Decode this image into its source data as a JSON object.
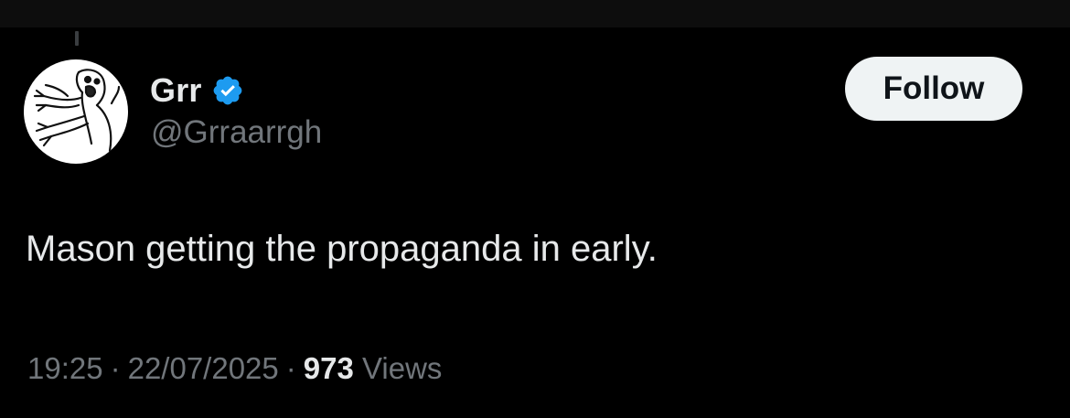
{
  "author": {
    "display_name": "Grr",
    "handle": "@Grraarrgh",
    "verified": true,
    "verified_color": "#1d9bf0",
    "avatar_icon": "creepy-creature-drawing-avatar"
  },
  "follow_button": {
    "label": "Follow"
  },
  "tweet": {
    "text": "Mason getting the propaganda in early."
  },
  "meta": {
    "time": "19:25",
    "date": "22/07/2025",
    "separator": "·",
    "views_count": "973",
    "views_label": "Views"
  },
  "colors": {
    "background": "#000000",
    "primary_text": "#e7e9ea",
    "secondary_text": "#71767b",
    "button_bg": "#eff3f4",
    "button_text": "#0f1419"
  }
}
